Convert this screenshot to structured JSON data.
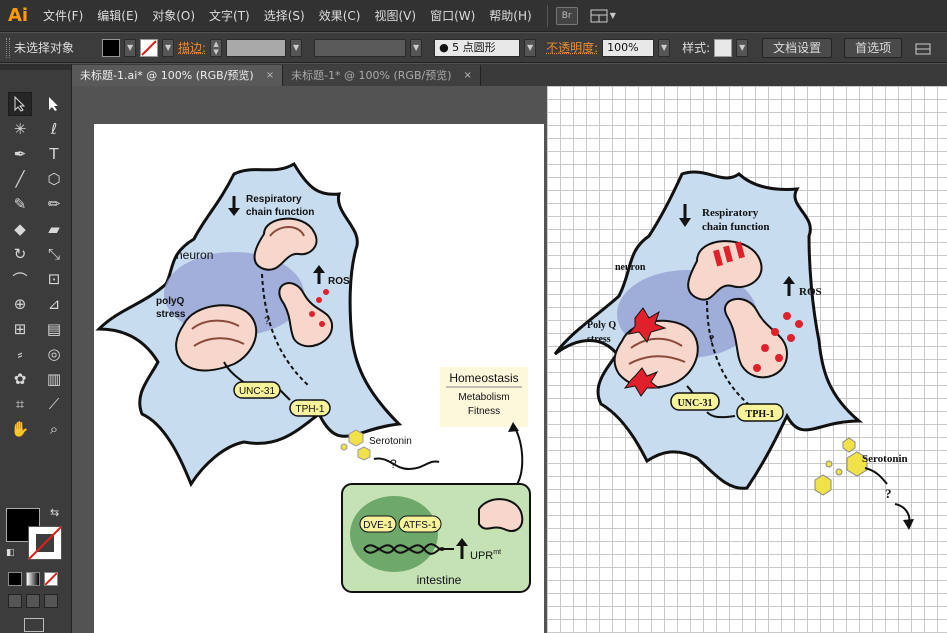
{
  "app": {
    "logo": "Ai"
  },
  "menu": [
    "文件(F)",
    "编辑(E)",
    "对象(O)",
    "文字(T)",
    "选择(S)",
    "效果(C)",
    "视图(V)",
    "窗口(W)",
    "帮助(H)"
  ],
  "bridge_label": "Br",
  "control": {
    "selection_status": "未选择对象",
    "stroke_label": "描边:",
    "brush_value": "5 点圆形",
    "opacity_label": "不透明度:",
    "opacity_value": "100%",
    "style_label": "样式:",
    "doc_setup_button": "文档设置",
    "prefs_button": "首选项"
  },
  "tabs": [
    {
      "title": "未标题-1.ai* @ 100% (RGB/预览)",
      "close": "×"
    },
    {
      "title": "未标题-1* @ 100% (RGB/预览)",
      "close": "×"
    }
  ],
  "colors": {
    "accent_orange": "#e98d33",
    "cell_fill": "#c8dcf0",
    "intestine_fill": "#c5e2b5",
    "nucleus_fill": "#9aa7d6",
    "mito_fill": "#f7d7cc",
    "label_yellow": "#f6f39a",
    "red_dot": "#e0202a"
  },
  "left_figure": {
    "respiratory": "Respiratory\nchain function",
    "neuron": "neuron",
    "polyq": "polyQ\nstress",
    "ros": "ROS",
    "question": "?",
    "unc31": "UNC-31",
    "tph1": "TPH-1",
    "serotonin": "Serotonin",
    "homeostasis_title": "Homeostasis",
    "homeostasis_items": [
      "Metabolism",
      "Fitness"
    ],
    "dve1": "DVE-1",
    "atfs1": "ATFS-1",
    "upr": "UPR",
    "upr_sup": "mt",
    "intestine": "intestine"
  },
  "right_figure": {
    "respiratory": "Respiratory\nchain function",
    "neuron": "neuron",
    "polyq": "Poly Q\nstress",
    "ros": "ROS",
    "question": "?",
    "unc31": "UNC-31",
    "tph1": "TPH-1",
    "serotonin": "Serotonin"
  }
}
